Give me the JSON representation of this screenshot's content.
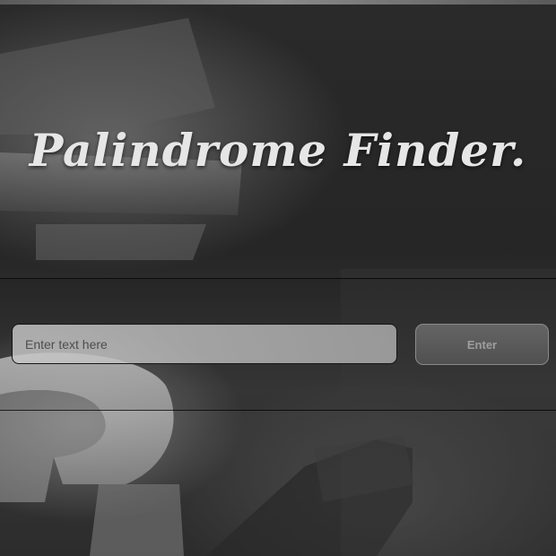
{
  "header": {
    "title": "Palindrome Finder."
  },
  "form": {
    "input_placeholder": "Enter text here",
    "input_value": "",
    "enter_label": "Enter"
  },
  "colors": {
    "title_text": "#e6e6e6",
    "input_background": "#c0c0c0",
    "button_background": "#5f5f5f",
    "button_text": "#9e9e9e"
  }
}
